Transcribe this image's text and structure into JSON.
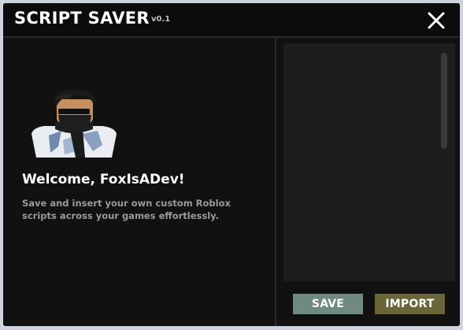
{
  "window": {
    "title": "SCRIPT SAVER",
    "version": "v0.1",
    "close_icon": "close-icon"
  },
  "welcome": {
    "heading": "Welcome, FoxIsADev!",
    "description": "Save and insert your own custom Roblox scripts across your games effortlessly.",
    "avatar_icon": "user-avatar"
  },
  "scripts": {
    "items": []
  },
  "actions": {
    "save_label": "SAVE",
    "import_label": "IMPORT"
  },
  "colors": {
    "window_bg": "#111111",
    "titlebar_bg": "#0c0c0c",
    "list_bg": "#1d1d1d",
    "save_button": "#6f8b80",
    "import_button": "#6b6638",
    "description_text": "#9a9a9a"
  }
}
